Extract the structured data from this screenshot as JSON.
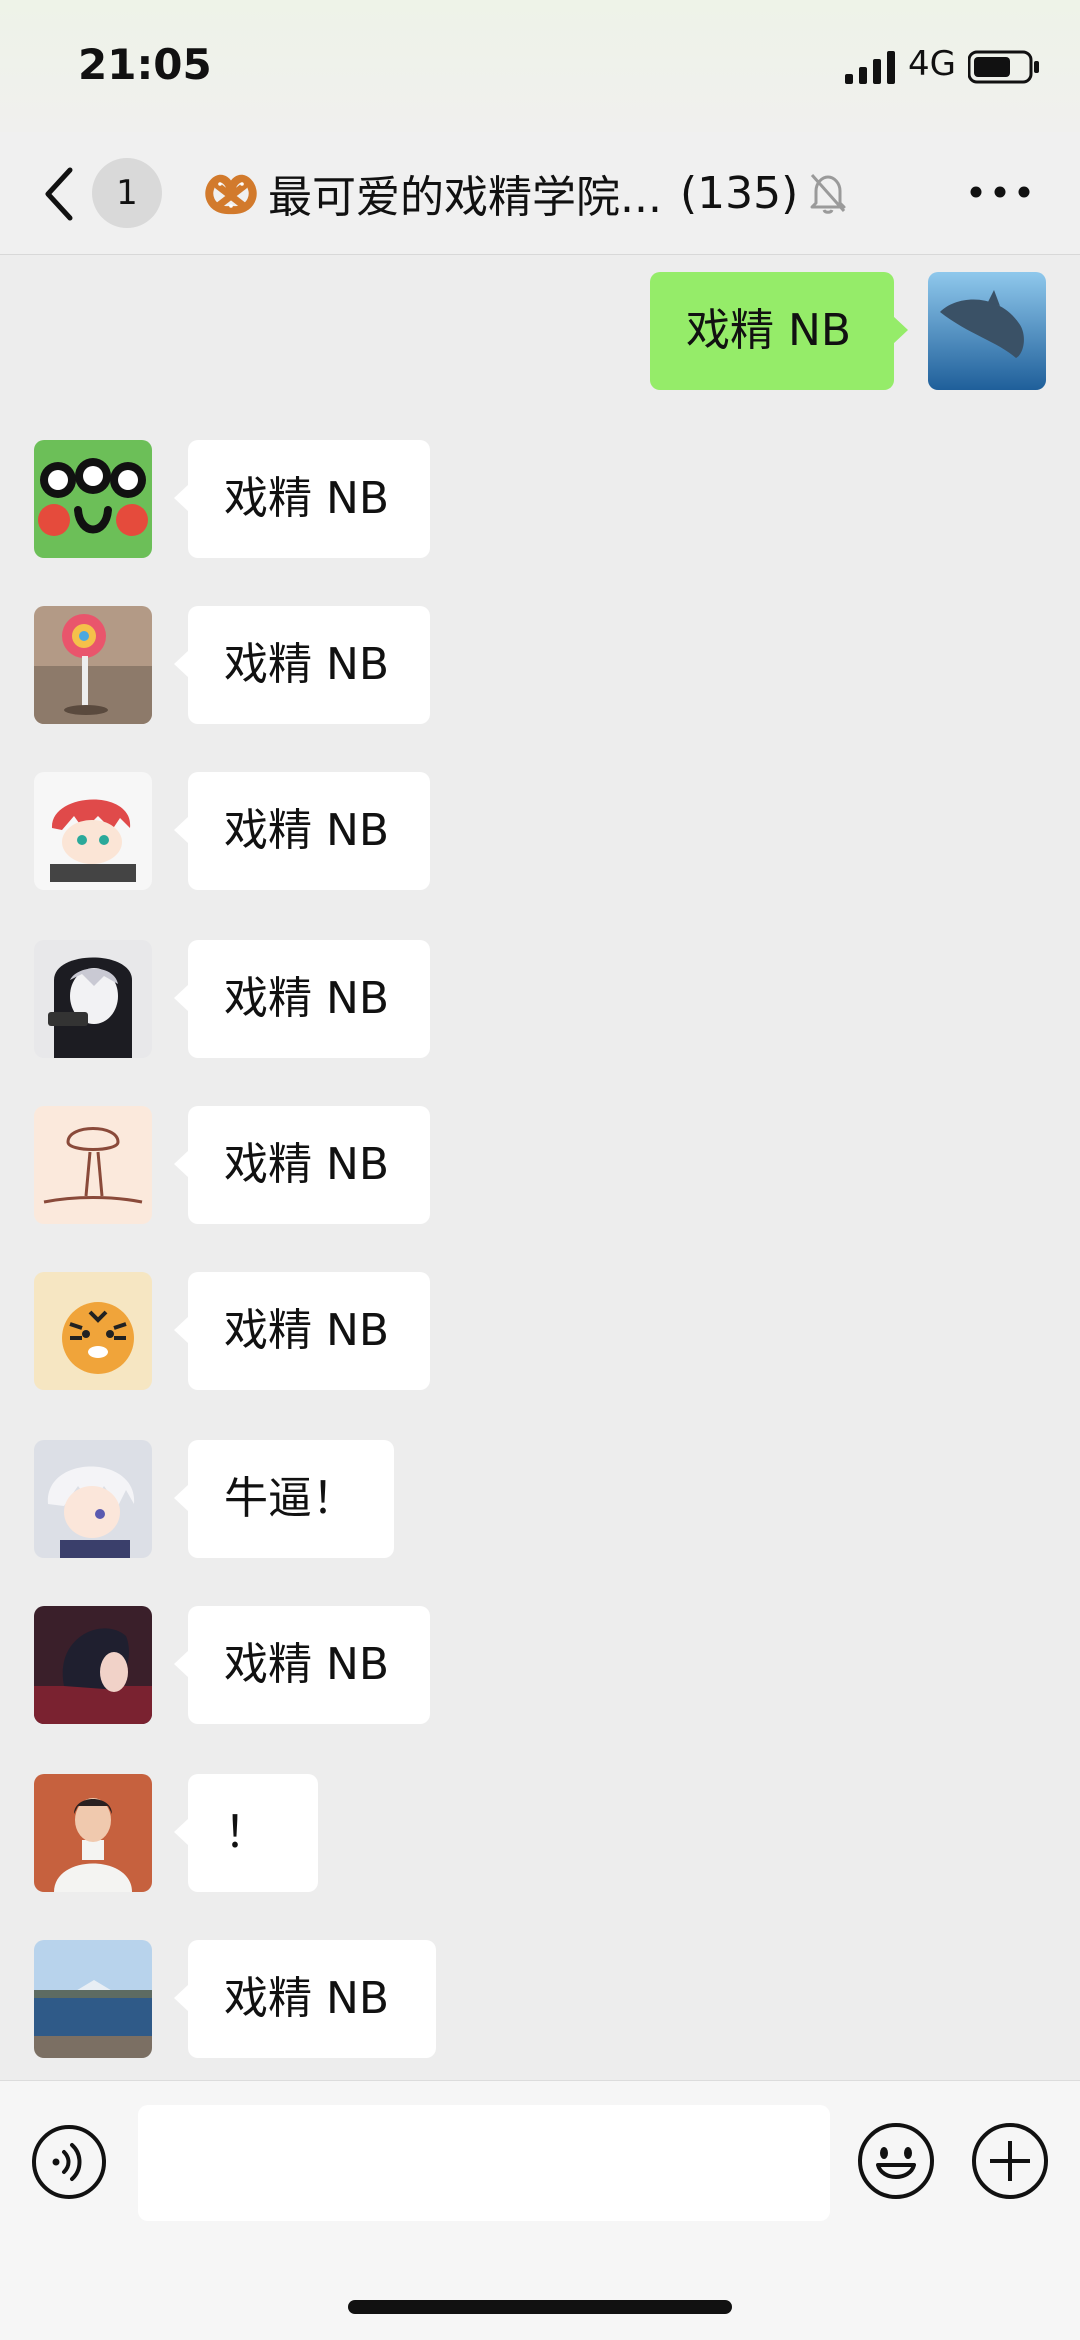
{
  "status_bar": {
    "time": "21:05",
    "network": "4G"
  },
  "header": {
    "unread_count": "1",
    "group_name": "最可爱的戏精学院...",
    "member_count": "(135)"
  },
  "messages": [
    {
      "sender": "me",
      "text": "戏精 NB"
    },
    {
      "sender": "other",
      "text": "戏精 NB"
    },
    {
      "sender": "other",
      "text": "戏精 NB"
    },
    {
      "sender": "other",
      "text": "戏精 NB"
    },
    {
      "sender": "other",
      "text": "戏精 NB"
    },
    {
      "sender": "other",
      "text": "戏精 NB"
    },
    {
      "sender": "other",
      "text": "戏精 NB"
    },
    {
      "sender": "other",
      "text": "牛逼！"
    },
    {
      "sender": "other",
      "text": "戏精 NB"
    },
    {
      "sender": "other",
      "text": "！"
    },
    {
      "sender": "other",
      "text": "戏精 NB"
    }
  ],
  "colors": {
    "my_bubble": "#95ec69",
    "other_bubble": "#ffffff",
    "background": "#ededed"
  }
}
